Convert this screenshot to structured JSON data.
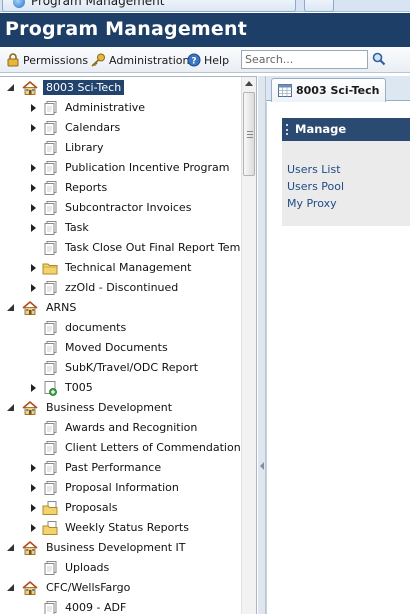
{
  "window": {
    "tab_title": "Program Management"
  },
  "header": {
    "title": "Program Management"
  },
  "toolbar": {
    "permissions_label": "Permissions",
    "administration_label": "Administration",
    "help_label": "Help",
    "search_placeholder": "Search..."
  },
  "tree": {
    "items": [
      {
        "label": "8003 Sci-Tech",
        "level": 0,
        "kind": "site",
        "expander": "expanded",
        "selected": true
      },
      {
        "label": "Administrative",
        "level": 1,
        "kind": "docs",
        "expander": "collapsed"
      },
      {
        "label": "Calendars",
        "level": 1,
        "kind": "docs",
        "expander": "collapsed"
      },
      {
        "label": "Library",
        "level": 1,
        "kind": "docs",
        "expander": "none"
      },
      {
        "label": "Publication Incentive Program",
        "level": 1,
        "kind": "docs",
        "expander": "collapsed"
      },
      {
        "label": "Reports",
        "level": 1,
        "kind": "docs",
        "expander": "collapsed"
      },
      {
        "label": "Subcontractor Invoices",
        "level": 1,
        "kind": "docs",
        "expander": "collapsed"
      },
      {
        "label": "Task",
        "level": 1,
        "kind": "docs",
        "expander": "collapsed"
      },
      {
        "label": "Task Close Out Final Report Templ",
        "level": 1,
        "kind": "docs",
        "expander": "none"
      },
      {
        "label": "Technical Management",
        "level": 1,
        "kind": "folder",
        "expander": "collapsed"
      },
      {
        "label": "zzOld - Discontinued",
        "level": 1,
        "kind": "docs",
        "expander": "collapsed"
      },
      {
        "label": "ARNS",
        "level": 0,
        "kind": "site",
        "expander": "expanded"
      },
      {
        "label": "documents",
        "level": 1,
        "kind": "docs",
        "expander": "none"
      },
      {
        "label": "Moved Documents",
        "level": 1,
        "kind": "docs",
        "expander": "none"
      },
      {
        "label": "SubK/Travel/ODC Report",
        "level": 1,
        "kind": "docs",
        "expander": "none"
      },
      {
        "label": "T005",
        "level": 1,
        "kind": "page-add",
        "expander": "collapsed"
      },
      {
        "label": "Business Development",
        "level": 0,
        "kind": "site",
        "expander": "expanded"
      },
      {
        "label": "Awards and Recognition",
        "level": 1,
        "kind": "docs",
        "expander": "none"
      },
      {
        "label": "Client Letters of Commendation",
        "level": 1,
        "kind": "docs",
        "expander": "none"
      },
      {
        "label": "Past Performance",
        "level": 1,
        "kind": "docs",
        "expander": "collapsed"
      },
      {
        "label": "Proposal Information",
        "level": 1,
        "kind": "docs",
        "expander": "collapsed"
      },
      {
        "label": "Proposals",
        "level": 1,
        "kind": "folder-docs",
        "expander": "collapsed"
      },
      {
        "label": "Weekly Status Reports",
        "level": 1,
        "kind": "folder-docs",
        "expander": "collapsed"
      },
      {
        "label": "Business Development IT",
        "level": 0,
        "kind": "site",
        "expander": "expanded"
      },
      {
        "label": "Uploads",
        "level": 1,
        "kind": "docs",
        "expander": "none"
      },
      {
        "label": "CFC/WellsFargo",
        "level": 0,
        "kind": "site",
        "expander": "expanded"
      },
      {
        "label": "4009 - ADF",
        "level": 1,
        "kind": "docs",
        "expander": "none"
      }
    ]
  },
  "main": {
    "tab_label": "8003 Sci-Tech",
    "manage": {
      "title": "Manage",
      "links": [
        "Users List",
        "Users Pool",
        "My Proxy"
      ]
    }
  },
  "colors": {
    "header_bg": "#1d3e66",
    "selection_bg": "#21436d",
    "manage_header_bg": "#2b4a72",
    "link": "#1e4b86"
  }
}
